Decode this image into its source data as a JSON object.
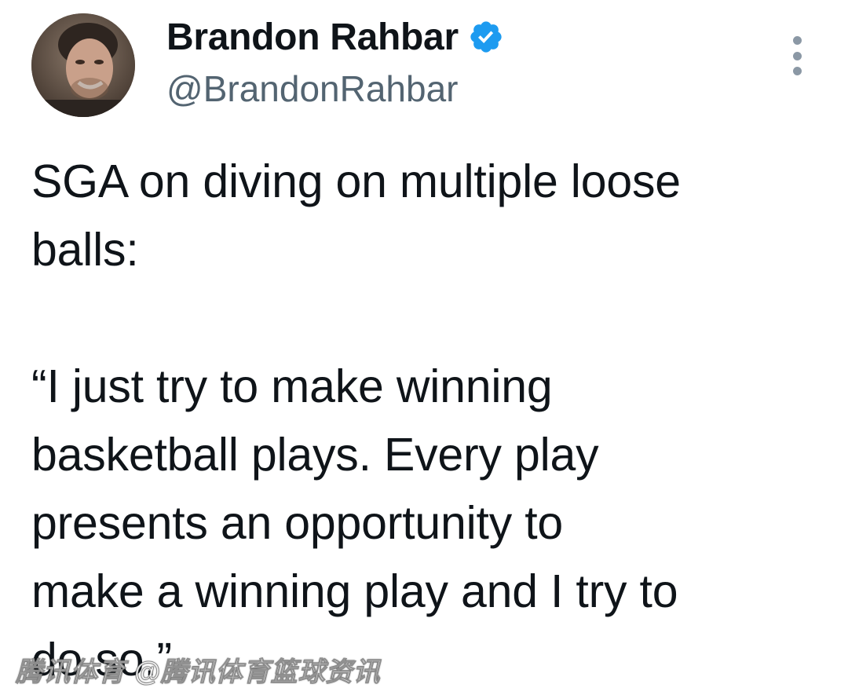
{
  "author": {
    "display_name": "Brandon Rahbar",
    "handle": "@BrandonRahbar",
    "verified_badge_icon": "verified-check-icon",
    "avatar_icon": "profile-photo"
  },
  "menu": {
    "more_icon": "more-vertical-icon"
  },
  "tweet": {
    "lines": [
      "SGA on diving on multiple loose",
      "balls:",
      "",
      "“I just try to make winning",
      "basketball plays. Every play",
      "presents an opportunity to",
      "make a winning play and I try to",
      "do so.”"
    ]
  },
  "watermark": {
    "text": "腾讯体育 @腾讯体育篮球资讯"
  },
  "colors": {
    "text": "#0f1419",
    "secondary": "#536471",
    "verified": "#1d9bf0",
    "background": "#ffffff"
  }
}
